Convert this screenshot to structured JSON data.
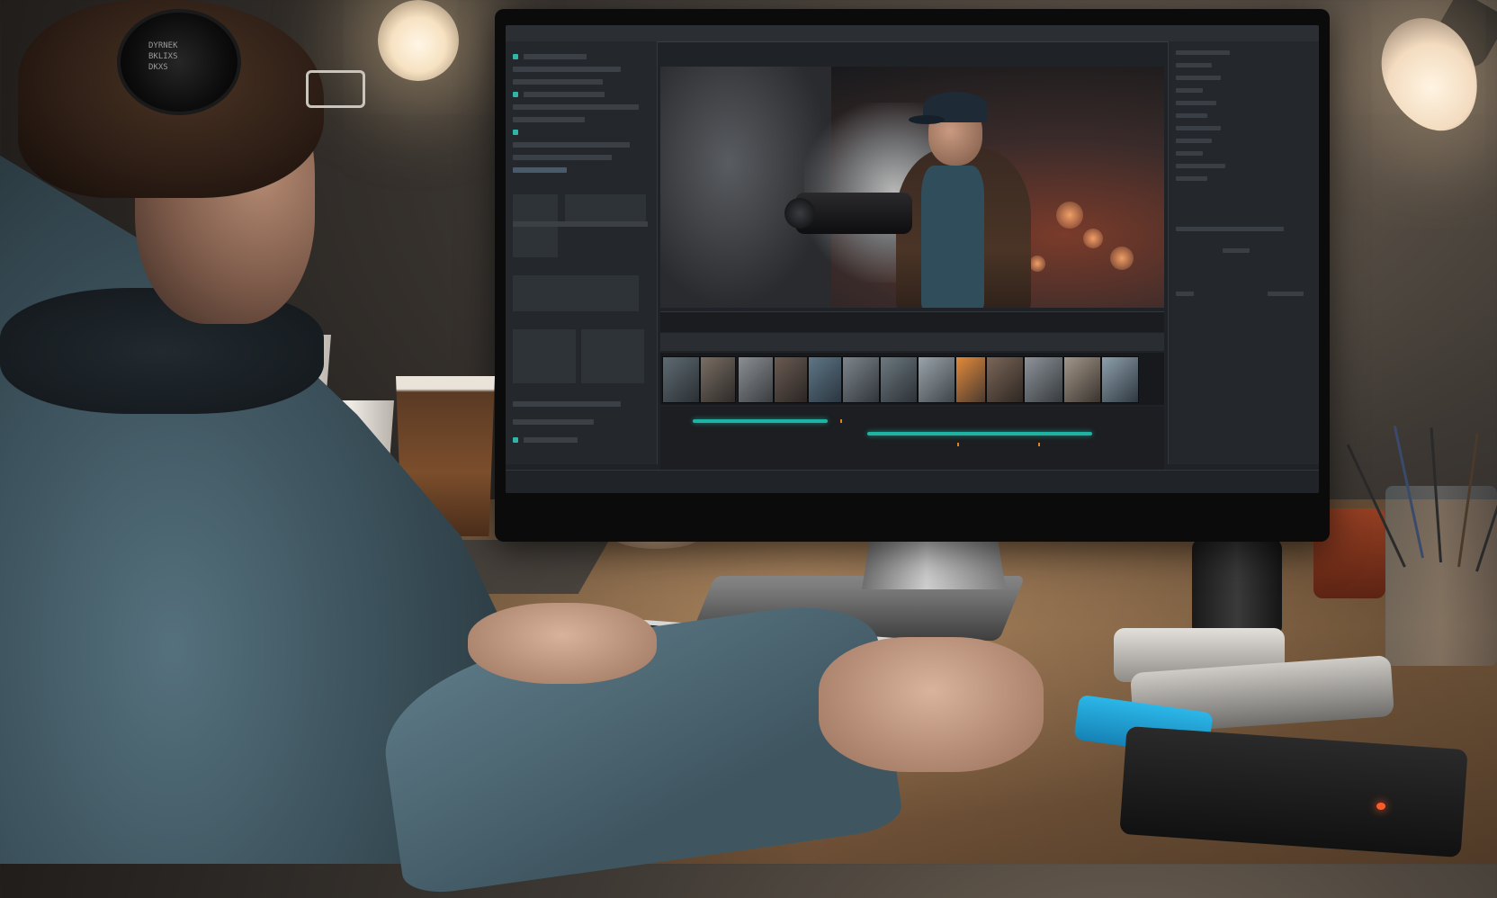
{
  "scene": {
    "description_label": "",
    "headphone_text": [
      "DYRNEK",
      "BKLIXS",
      "DKXS"
    ]
  },
  "colors": {
    "timeline_accent": "#1fb3a3",
    "ui_background": "#1f2226",
    "desk_wood": "#8d6a48"
  }
}
